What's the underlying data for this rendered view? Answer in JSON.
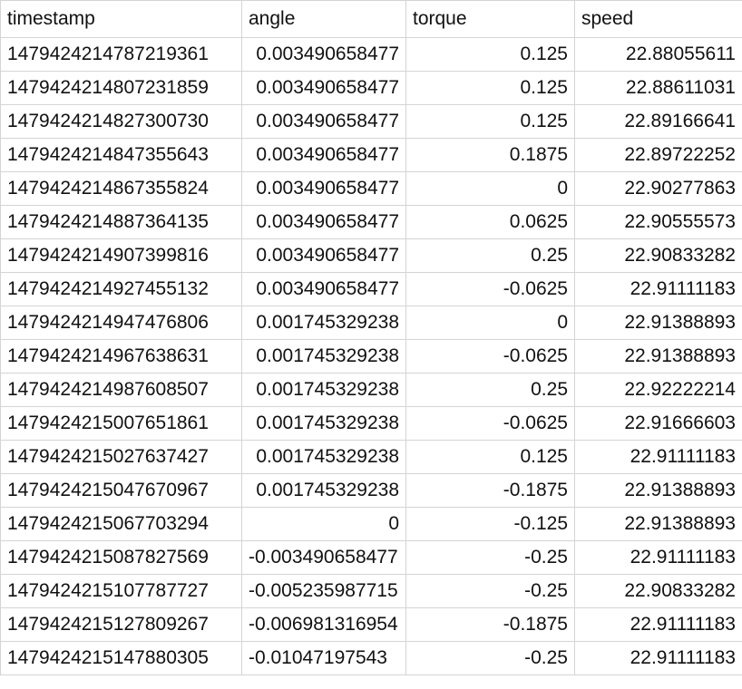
{
  "spreadsheet": {
    "columns": [
      "timestamp",
      "angle",
      "torque",
      "speed"
    ],
    "rows": [
      [
        "1479424214787219361",
        "0.003490658477",
        "0.125",
        "22.88055611"
      ],
      [
        "1479424214807231859",
        "0.003490658477",
        "0.125",
        "22.88611031"
      ],
      [
        "1479424214827300730",
        "0.003490658477",
        "0.125",
        "22.89166641"
      ],
      [
        "1479424214847355643",
        "0.003490658477",
        "0.1875",
        "22.89722252"
      ],
      [
        "1479424214867355824",
        "0.003490658477",
        "0",
        "22.90277863"
      ],
      [
        "1479424214887364135",
        "0.003490658477",
        "0.0625",
        "22.90555573"
      ],
      [
        "1479424214907399816",
        "0.003490658477",
        "0.25",
        "22.90833282"
      ],
      [
        "1479424214927455132",
        "0.003490658477",
        "-0.0625",
        "22.91111183"
      ],
      [
        "1479424214947476806",
        "0.001745329238",
        "0",
        "22.91388893"
      ],
      [
        "1479424214967638631",
        "0.001745329238",
        "-0.0625",
        "22.91388893"
      ],
      [
        "1479424214987608507",
        "0.001745329238",
        "0.25",
        "22.92222214"
      ],
      [
        "1479424215007651861",
        "0.001745329238",
        "-0.0625",
        "22.91666603"
      ],
      [
        "1479424215027637427",
        "0.001745329238",
        "0.125",
        "22.91111183"
      ],
      [
        "1479424215047670967",
        "0.001745329238",
        "-0.1875",
        "22.91388893"
      ],
      [
        "1479424215067703294",
        "0",
        "-0.125",
        "22.91388893"
      ],
      [
        "1479424215087827569",
        "-0.003490658477",
        "-0.25",
        "22.91111183"
      ],
      [
        "1479424215107787727",
        "-0.005235987715",
        "-0.25",
        "22.90833282"
      ],
      [
        "1479424215127809267",
        "-0.006981316954",
        "-0.1875",
        "22.91111183"
      ],
      [
        "1479424215147880305",
        "-0.01047197543",
        "-0.25",
        "22.91111183"
      ]
    ]
  }
}
